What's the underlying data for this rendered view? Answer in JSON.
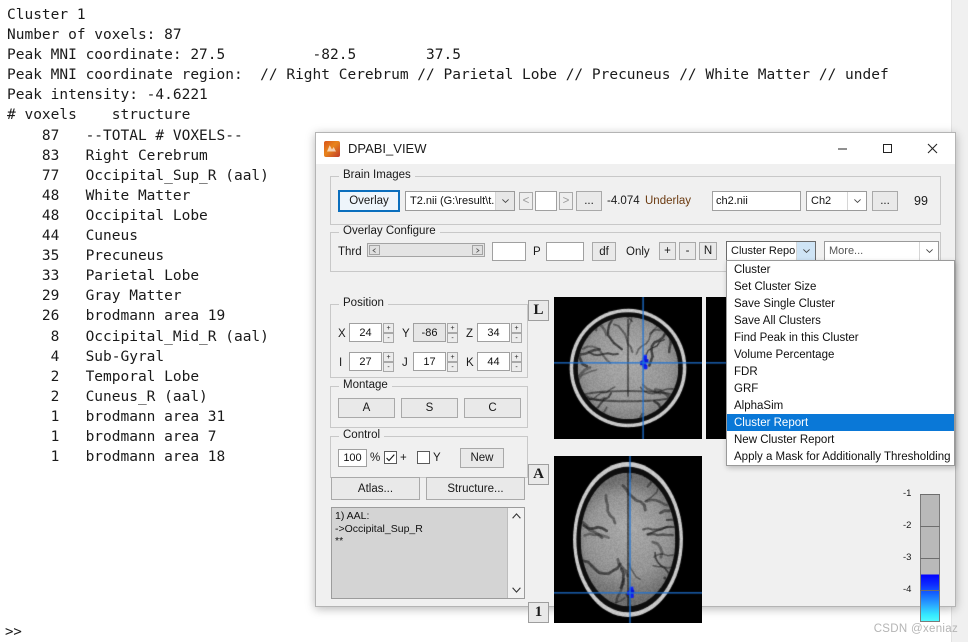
{
  "console": {
    "lines": [
      "Cluster 1",
      "Number of voxels: 87",
      "Peak MNI coordinate: 27.5          -82.5        37.5",
      "Peak MNI coordinate region:  // Right Cerebrum // Parietal Lobe // Precuneus // White Matter // undef",
      "Peak intensity: -4.6221",
      "# voxels    structure",
      "    87   --TOTAL # VOXELS--",
      "    83   Right Cerebrum",
      "    77   Occipital_Sup_R (aal)",
      "    48   White Matter",
      "    48   Occipital Lobe",
      "    44   Cuneus",
      "    35   Precuneus",
      "    33   Parietal Lobe",
      "    29   Gray Matter",
      "    26   brodmann area 19",
      "     8   Occipital_Mid_R (aal)",
      "     4   Sub-Gyral",
      "     2   Temporal Lobe",
      "     2   Cuneus_R (aal)",
      "     1   brodmann area 31",
      "     1   brodmann area 7",
      "     1   brodmann area 18"
    ],
    "prompt": ">>"
  },
  "window": {
    "title": "DPABI_VIEW",
    "minimize_label": "–",
    "maximize_label": "☐",
    "close_label": "✕"
  },
  "brain_images": {
    "group_label": "Brain Images",
    "overlay_button": "Overlay",
    "overlay_file": "T2.nii (G:\\result\\t...",
    "prev_label": "<",
    "index_value": "",
    "next_label": ">",
    "browse_label": "...",
    "overlay_value": "-4.074",
    "underlay_label": "Underlay",
    "underlay_file": "ch2.nii",
    "underlay_preset": "Ch2",
    "underlay_browse_label": "...",
    "underlay_value": "99"
  },
  "overlay_configure": {
    "group_label": "Overlay Configure",
    "thrd_label": "Thrd",
    "thrd_value": "",
    "p_label": "P",
    "p_value": "",
    "df_label": "df",
    "only_label": "Only",
    "plus_label": "+",
    "minus_label": "-",
    "n_label": "N",
    "cluster_report_selected": "Cluster Report",
    "more_selected": "More..."
  },
  "cluster_menu": {
    "items": [
      "Cluster",
      "Set Cluster Size",
      "Save Single Cluster",
      "Save All Clusters",
      "Find Peak in this Cluster",
      "Volume Percentage",
      "FDR",
      "GRF",
      "AlphaSim",
      "Cluster Report",
      "New Cluster Report",
      "Apply a Mask for Additionally Thresholding"
    ],
    "active_index": 9,
    "highlight_color": "#0a78d7"
  },
  "position": {
    "group_label": "Position",
    "x_label": "X",
    "x_value": "24",
    "y_label": "Y",
    "y_value": "-86",
    "z_label": "Z",
    "z_value": "34",
    "i_label": "I",
    "i_value": "27",
    "j_label": "J",
    "j_value": "17",
    "k_label": "K",
    "k_value": "44"
  },
  "montage": {
    "group_label": "Montage",
    "a_label": "A",
    "s_label": "S",
    "c_label": "C"
  },
  "control": {
    "group_label": "Control",
    "zoom_value": "100",
    "percent_label": "%",
    "plus_checkbox_label": "+",
    "y_checkbox_label": "Y",
    "new_label": "New"
  },
  "actions": {
    "atlas_label": "Atlas...",
    "structure_label": "Structure..."
  },
  "aal_list": {
    "text": "1) AAL:\n->Occipital_Sup_R\n**"
  },
  "viewer": {
    "orient_left": "L",
    "orient_anterior": "A",
    "slice_number": "1"
  },
  "colorbar": {
    "ticks": [
      "-1",
      "-2",
      "-3",
      "-4"
    ]
  },
  "watermark": "CSDN @xeniaz"
}
